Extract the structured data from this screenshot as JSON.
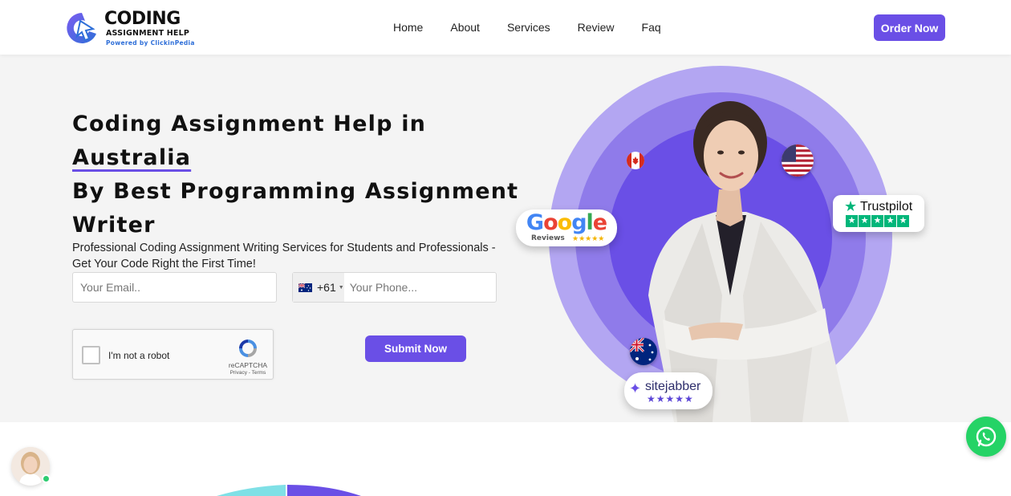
{
  "brand": {
    "title": "CODING",
    "subtitle": "ASSIGNMENT HELP",
    "powered": "Powered by ClickinPedia"
  },
  "nav": {
    "items": [
      "Home",
      "About",
      "Services",
      "Review",
      "Faq"
    ],
    "order_label": "Order Now"
  },
  "hero": {
    "heading_part1": "Coding Assignment Help in ",
    "heading_highlight": "Australia",
    "heading_part2": "By Best Programming Assignment Writer",
    "subtext": "Professional Coding Assignment Writing Services for Students and Professionals - Get Your Code Right the First Time!",
    "email_placeholder": "Your Email..",
    "phone_code": "+61",
    "phone_placeholder": "Your Phone...",
    "captcha_label": "I'm not a robot",
    "captcha_brand": "reCAPTCHA",
    "captcha_terms": "Privacy - Terms",
    "submit_label": "Submit Now"
  },
  "badges": {
    "google_word": "Google",
    "google_sub": "Reviews",
    "google_stars": "★★★★★",
    "trust_word": "Trustpilot",
    "site_word": "sitejabber",
    "site_stars": "★★★★★"
  },
  "colors": {
    "accent": "#6a4fe6",
    "whatsapp": "#25d366",
    "trustpilot": "#00b67a"
  },
  "icons": [
    "logo-mark-icon",
    "australia-flag-icon",
    "canada-flag-icon",
    "usa-flag-icon",
    "recaptcha-icon",
    "whatsapp-icon",
    "trustpilot-star-icon",
    "sitejabber-icon"
  ]
}
